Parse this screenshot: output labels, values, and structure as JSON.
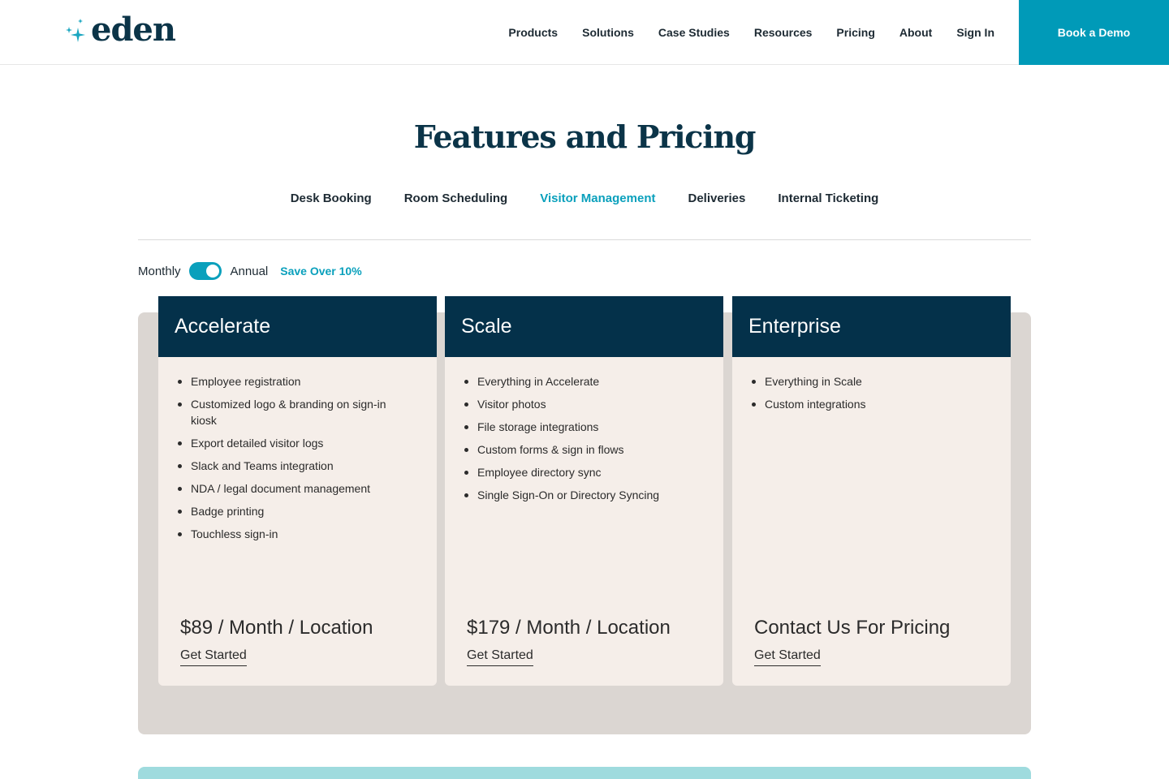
{
  "brand": {
    "name": "eden"
  },
  "nav": {
    "items": [
      "Products",
      "Solutions",
      "Case Studies",
      "Resources",
      "Pricing",
      "About",
      "Sign In"
    ],
    "cta": "Book a Demo"
  },
  "page": {
    "title": "Features and Pricing"
  },
  "tabs": {
    "items": [
      "Desk Booking",
      "Room Scheduling",
      "Visitor Management",
      "Deliveries",
      "Internal Ticketing"
    ],
    "active": "Visitor Management"
  },
  "billing": {
    "monthly_label": "Monthly",
    "annual_label": "Annual",
    "save_label": "Save Over 10%",
    "annual_selected": true
  },
  "plans": [
    {
      "name": "Accelerate",
      "features": [
        "Employee registration",
        "Customized logo & branding on sign-in kiosk",
        "Export detailed visitor logs",
        "Slack and Teams integration",
        "NDA / legal document management",
        "Badge printing",
        "Touchless sign-in"
      ],
      "price": "$89 / Month / Location",
      "cta": "Get Started"
    },
    {
      "name": "Scale",
      "features": [
        "Everything in Accelerate",
        "Visitor photos",
        "File storage integrations",
        "Custom forms & sign in flows",
        "Employee directory sync",
        "Single Sign-On or Directory Syncing"
      ],
      "price": "$179 / Month / Location",
      "cta": "Get Started"
    },
    {
      "name": "Enterprise",
      "features": [
        "Everything in Scale",
        "Custom integrations"
      ],
      "price": "Contact Us For Pricing",
      "cta": "Get Started"
    }
  ],
  "colors": {
    "brand_navy": "#04314a",
    "accent_teal": "#0aa0bc",
    "demo_button": "#009ab8",
    "card_bg": "#f5eee9",
    "panel_bg": "#dbd6d2",
    "strip_teal": "#9fdbde"
  },
  "icons": {
    "logo": "sparkle-icon",
    "toggle": "toggle-switch"
  }
}
